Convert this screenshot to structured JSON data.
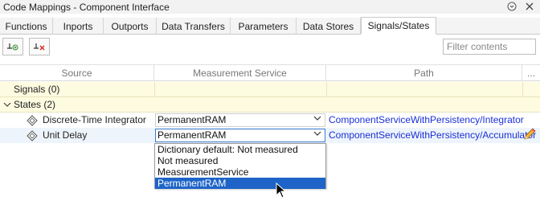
{
  "window": {
    "title": "Code Mappings - Component Interface",
    "help_icon": "help-circle-icon",
    "close_icon": "close-icon"
  },
  "tabs": [
    {
      "label": "Functions"
    },
    {
      "label": "Inports"
    },
    {
      "label": "Outports"
    },
    {
      "label": "Data Transfers"
    },
    {
      "label": "Parameters"
    },
    {
      "label": "Data Stores"
    },
    {
      "label": "Signals/States",
      "active": true
    }
  ],
  "toolbar": {
    "add_icon": "add-signal-icon",
    "remove_icon": "remove-signal-icon",
    "filter_placeholder": "Filter contents"
  },
  "table": {
    "columns": [
      "Source",
      "Measurement Service",
      "Path",
      "..."
    ],
    "groups": [
      {
        "label": "Signals (0)",
        "expanded": false
      },
      {
        "label": "States (2)",
        "expanded": true
      }
    ],
    "rows": [
      {
        "source": "Discrete-Time Integrator",
        "measurement": "PermanentRAM",
        "path": "ComponentServiceWithPersistency/Integrator"
      },
      {
        "source": "Unit Delay",
        "measurement": "PermanentRAM",
        "path": "ComponentServiceWithPersistency/Accumulator",
        "selected": true
      }
    ]
  },
  "dropdown": {
    "options": [
      "Dictionary default: Not measured",
      "Not measured",
      "MeasurementService",
      "PermanentRAM"
    ],
    "selected": "PermanentRAM"
  },
  "colors": {
    "path_link": "#1a2fd6",
    "group_bg": "#fdfbe0",
    "selection": "#1e64c8"
  }
}
